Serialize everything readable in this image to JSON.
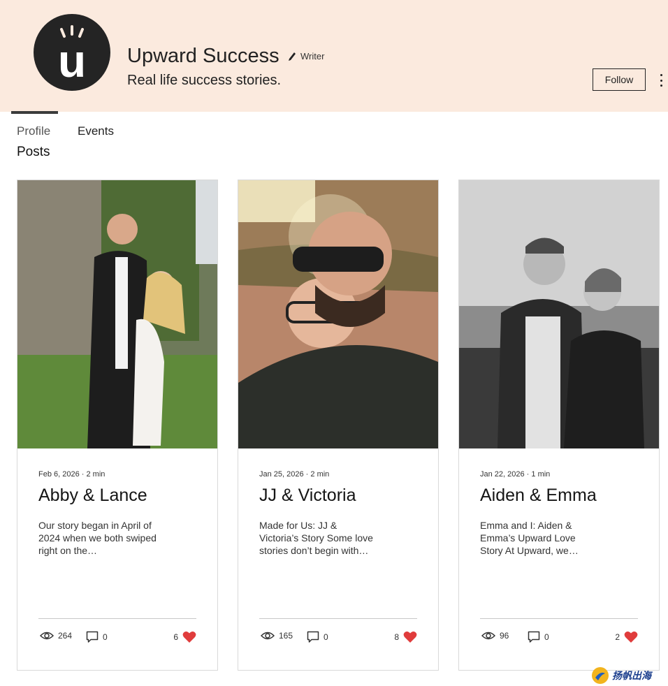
{
  "header": {
    "logo_letter": "u",
    "title": "Upward Success",
    "role": "Writer",
    "tagline": "Real life success stories.",
    "follow_label": "Follow",
    "background_color": "#fbeade"
  },
  "tabs": [
    {
      "label": "Profile",
      "active": true
    },
    {
      "label": "Events",
      "active": false
    }
  ],
  "section_title": "Posts",
  "posts": [
    {
      "date": "Feb 6, 2026",
      "read_time": "2 min",
      "title": "Abby & Lance",
      "excerpt": "Our story began in April of 2024 when we both swiped right on the…",
      "views": "264",
      "comments": "0",
      "likes": "6"
    },
    {
      "date": "Jan 25, 2026",
      "read_time": "2 min",
      "title": "JJ & Victoria",
      "excerpt": "Made for Us: JJ & Victoria’s Story Some love stories don’t begin with…",
      "views": "165",
      "comments": "0",
      "likes": "8"
    },
    {
      "date": "Jan 22, 2026",
      "read_time": "1 min",
      "title": "Aiden & Emma",
      "excerpt": "Emma and I: Aiden & Emma’s Upward Love Story At Upward, we…",
      "views": "96",
      "comments": "0",
      "likes": "2"
    }
  ],
  "icons": {
    "views": "eye-icon",
    "comments": "comment-icon",
    "likes": "heart-icon",
    "role": "pen-icon",
    "more": "more-vertical-icon"
  },
  "colors": {
    "like_heart": "#e03c3c"
  },
  "watermark": "扬帆出海"
}
